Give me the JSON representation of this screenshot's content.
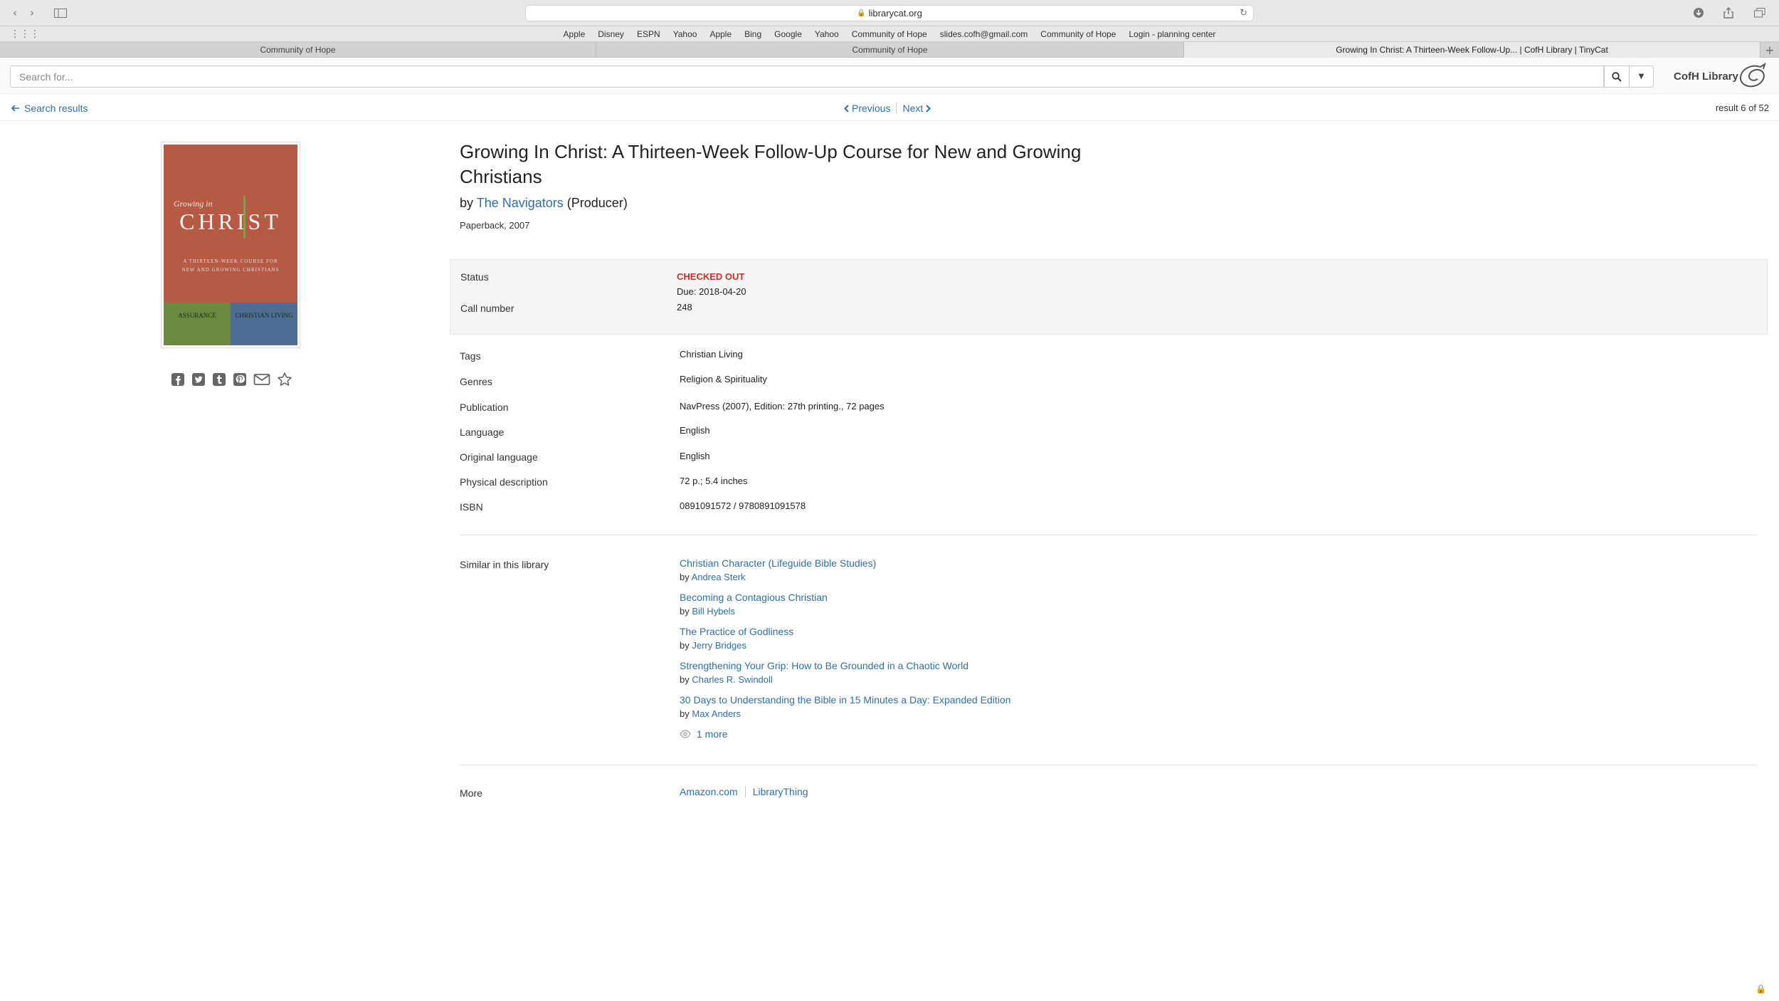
{
  "browser": {
    "url": "librarycat.org",
    "favorites": [
      "Apple",
      "Disney",
      "ESPN",
      "Yahoo",
      "Apple",
      "Bing",
      "Google",
      "Yahoo",
      "Community of Hope",
      "slides.cofh@gmail.com",
      "Community of Hope",
      "Login - planning center"
    ],
    "tabs": [
      "Community of Hope",
      "Community of Hope",
      "Growing In Christ: A Thirteen-Week Follow-Up... | CofH Library | TinyCat"
    ]
  },
  "header": {
    "search_placeholder": "Search for...",
    "library_name": "CofH Library"
  },
  "nav": {
    "back_label": "Search results",
    "previous_label": "Previous",
    "next_label": "Next",
    "result_count": "result 6 of 52"
  },
  "cover": {
    "line1": "Growing in",
    "line2": "CHRIST",
    "subtitle1": "A THIRTEEN-WEEK COURSE FOR",
    "subtitle2": "NEW AND GROWING CHRISTIANS",
    "left_panel": "ASSURANCE",
    "right_panel": "CHRISTIAN LIVING"
  },
  "book": {
    "title": "Growing In Christ: A Thirteen-Week Follow-Up Course for New and Growing Christians",
    "by_prefix": "by",
    "author": "The Navigators",
    "author_role": "(Producer)",
    "format": "Paperback, 2007"
  },
  "status": {
    "status_label": "Status",
    "status_value": "CHECKED OUT",
    "due": "Due: 2018-04-20",
    "call_number_label": "Call number",
    "call_number": "248"
  },
  "details": {
    "tags_label": "Tags",
    "tags": "Christian Living",
    "genres_label": "Genres",
    "genres": "Religion & Spirituality",
    "publication_label": "Publication",
    "publication": "NavPress (2007), Edition: 27th printing., 72 pages",
    "language_label": "Language",
    "language": "English",
    "original_language_label": "Original language",
    "original_language": "English",
    "physical_label": "Physical description",
    "physical": "72 p.; 5.4 inches",
    "isbn_label": "ISBN",
    "isbn": "0891091572 / 9780891091578"
  },
  "similar": {
    "label": "Similar in this library",
    "by_prefix": "by",
    "items": [
      {
        "title": "Christian Character (Lifeguide Bible Studies)",
        "author": "Andrea Sterk"
      },
      {
        "title": "Becoming a Contagious Christian",
        "author": "Bill Hybels"
      },
      {
        "title": "The Practice of Godliness",
        "author": "Jerry Bridges"
      },
      {
        "title": "Strengthening Your Grip: How to Be Grounded in a Chaotic World",
        "author": "Charles R. Swindoll"
      },
      {
        "title": "30 Days to Understanding the Bible in 15 Minutes a Day: Expanded Edition",
        "author": "Max Anders"
      }
    ],
    "more_label": "1 more"
  },
  "more": {
    "label": "More",
    "links": [
      "Amazon.com",
      "LibraryThing"
    ]
  },
  "colors": {
    "link": "#2f6fa8",
    "checked_out": "#c9302c"
  },
  "icons": {
    "share": [
      "facebook-icon",
      "twitter-icon",
      "tumblr-icon",
      "pinterest-icon",
      "email-icon",
      "star-icon"
    ]
  }
}
